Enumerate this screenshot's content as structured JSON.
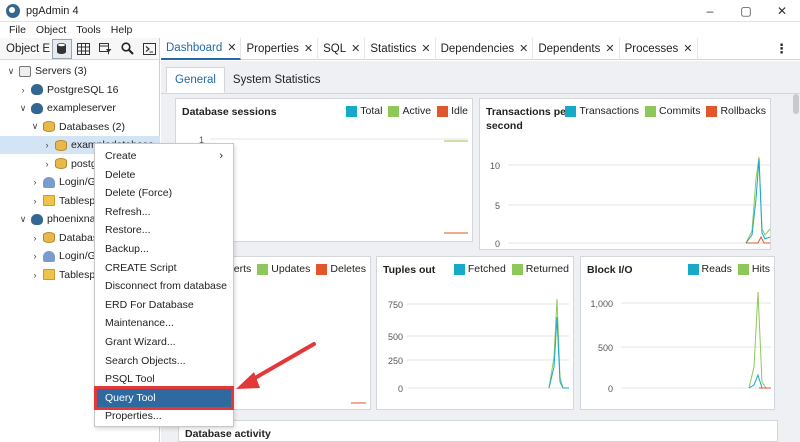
{
  "window": {
    "title": "pgAdmin 4",
    "controls": [
      "–",
      "▢",
      "✕"
    ]
  },
  "menubar": [
    "File",
    "Object",
    "Tools",
    "Help"
  ],
  "explorer": {
    "title": "Object Ex",
    "toolbar_icons": [
      "database-icon",
      "table-icon",
      "filter-icon",
      "search-icon",
      "terminal-icon"
    ]
  },
  "tree": [
    {
      "label": "Servers (3)",
      "icon": "server-group-icon",
      "chev": "∨",
      "indent": 0,
      "selected": false
    },
    {
      "label": "PostgreSQL 16",
      "icon": "server-icon",
      "chev": "›",
      "indent": 1,
      "selected": false
    },
    {
      "label": "exampleserver",
      "icon": "server-icon",
      "chev": "∨",
      "indent": 1,
      "selected": false
    },
    {
      "label": "Databases (2)",
      "icon": "databases-icon",
      "chev": "∨",
      "indent": 2,
      "selected": false
    },
    {
      "label": "exampledatabase",
      "icon": "database-icon",
      "chev": "›",
      "indent": 3,
      "selected": true
    },
    {
      "label": "postg",
      "icon": "database-icon",
      "chev": "›",
      "indent": 3,
      "selected": false
    },
    {
      "label": "Login/Gr",
      "icon": "users-icon",
      "chev": "›",
      "indent": 2,
      "selected": false
    },
    {
      "label": "Tablespa",
      "icon": "folder-icon",
      "chev": "›",
      "indent": 2,
      "selected": false
    },
    {
      "label": "phoenixnap",
      "icon": "server-icon",
      "chev": "∨",
      "indent": 1,
      "selected": false
    },
    {
      "label": "Databas",
      "icon": "databases-icon",
      "chev": "›",
      "indent": 2,
      "selected": false
    },
    {
      "label": "Login/Gr",
      "icon": "users-icon",
      "chev": "›",
      "indent": 2,
      "selected": false
    },
    {
      "label": "Tablespa",
      "icon": "folder-icon",
      "chev": "›",
      "indent": 2,
      "selected": false
    }
  ],
  "tabs": [
    {
      "label": "Dashboard",
      "active": true,
      "close": "✕"
    },
    {
      "label": "Properties",
      "active": false,
      "close": "✕"
    },
    {
      "label": "SQL",
      "active": false,
      "close": "✕"
    },
    {
      "label": "Statistics",
      "active": false,
      "close": "✕"
    },
    {
      "label": "Dependencies",
      "active": false,
      "close": "✕"
    },
    {
      "label": "Dependents",
      "active": false,
      "close": "✕"
    },
    {
      "label": "Processes",
      "active": false,
      "close": "✕"
    }
  ],
  "tabs_menu": "⋮",
  "subtabs": [
    "General",
    "System Statistics"
  ],
  "cards": {
    "sessions": {
      "title": "Database sessions",
      "legend": [
        {
          "label": "Total",
          "color": "#17a9c8"
        },
        {
          "label": "Active",
          "color": "#8fc85a"
        },
        {
          "label": "Idle",
          "color": "#e2572a"
        }
      ],
      "yticks": [
        "1"
      ]
    },
    "transactions": {
      "title": "Transactions per second",
      "legend": [
        {
          "label": "Transactions",
          "color": "#17a9c8"
        },
        {
          "label": "Commits",
          "color": "#8fc85a"
        },
        {
          "label": "Rollbacks",
          "color": "#e2572a"
        }
      ],
      "yticks": [
        "10",
        "5",
        "0"
      ]
    },
    "tuples_in": {
      "legend": [
        {
          "label": "Inserts",
          "color": null
        },
        {
          "label": "Updates",
          "color": "#8fc85a"
        },
        {
          "label": "Deletes",
          "color": "#e2572a"
        }
      ],
      "label_prefix": "nserts"
    },
    "tuples_out": {
      "title": "Tuples out",
      "legend": [
        {
          "label": "Fetched",
          "color": "#17a9c8"
        },
        {
          "label": "Returned",
          "color": "#8fc85a"
        }
      ],
      "yticks": [
        "750",
        "500",
        "250",
        "0"
      ]
    },
    "block_io": {
      "title": "Block I/O",
      "legend": [
        {
          "label": "Reads",
          "color": "#17a9c8"
        },
        {
          "label": "Hits",
          "color": "#8fc85a"
        }
      ],
      "yticks": [
        "1,000",
        "500",
        "0"
      ]
    },
    "activity": {
      "title": "Database activity"
    }
  },
  "context_menu": {
    "items": [
      {
        "label": "Create",
        "submenu": "›"
      },
      {
        "label": "Delete"
      },
      {
        "label": "Delete (Force)"
      },
      {
        "label": "Refresh..."
      },
      {
        "label": "Restore..."
      },
      {
        "label": "Backup..."
      },
      {
        "label": "CREATE Script"
      },
      {
        "label": "Disconnect from database"
      },
      {
        "label": "ERD For Database"
      },
      {
        "label": "Maintenance..."
      },
      {
        "label": "Grant Wizard..."
      },
      {
        "label": "Search Objects..."
      },
      {
        "label": "PSQL Tool"
      },
      {
        "label": "Query Tool",
        "highlighted": true
      },
      {
        "label": "Properties..."
      }
    ]
  },
  "annotation_color": "#e23838"
}
